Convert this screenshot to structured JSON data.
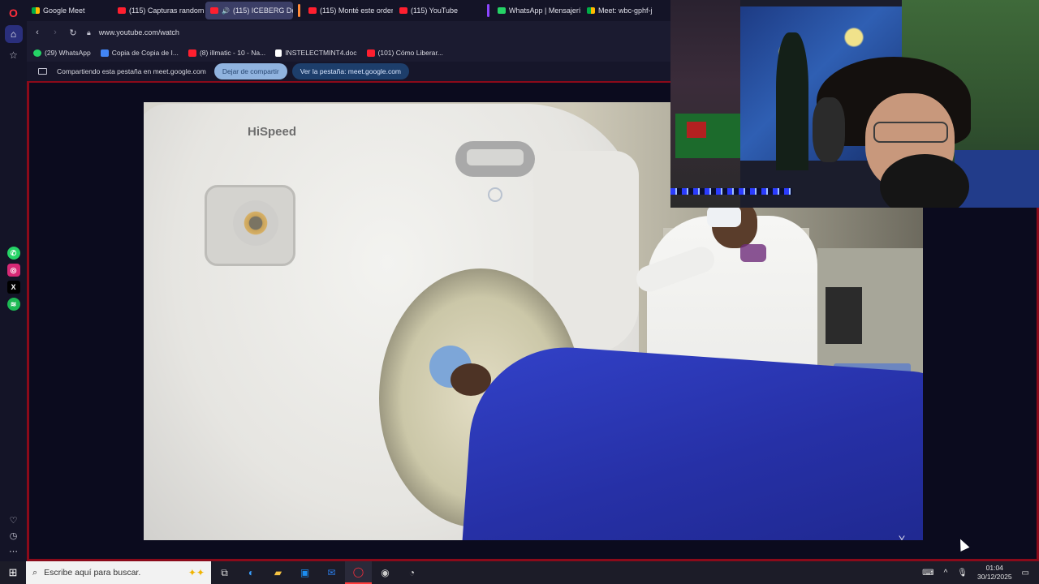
{
  "tabs": [
    {
      "label": "Google Meet",
      "favicon": "meet-icon"
    },
    {
      "label": "(115) Capturas random sin",
      "favicon": "youtube-icon"
    },
    {
      "label": "(115) ICEBERG De CA",
      "favicon": "youtube-icon",
      "active": true
    },
    {
      "label": "(115) Monté este ordenad",
      "favicon": "youtube-icon"
    },
    {
      "label": "(115) YouTube",
      "favicon": "youtube-icon"
    },
    {
      "label": "WhatsApp | Mensajería y",
      "favicon": "whatsapp-icon"
    },
    {
      "label": "Meet: wbc-gphf-j",
      "favicon": "meet-icon"
    }
  ],
  "address": {
    "url": "www.youtube.com/watch"
  },
  "bookmarks": [
    {
      "label": "(29) WhatsApp",
      "color": "#25d366"
    },
    {
      "label": "Copia de Copia de I...",
      "color": "#4285f4"
    },
    {
      "label": "(8) illmatic - 10 - Na...",
      "color": "#ff1f2f"
    },
    {
      "label": "INSTELECTMINT4.doc",
      "color": "#ffffff"
    },
    {
      "label": "(101) Cómo Liberar...",
      "color": "#ff1f2f"
    }
  ],
  "sharebar": {
    "text": "Compartiendo esta pestaña en meet.google.com",
    "stop_label": "Dejar de compartir",
    "view_label": "Ver la pestaña: meet.google.com"
  },
  "video": {
    "brand": "HiSpeed",
    "watermark": "Y."
  },
  "taskbar": {
    "search_placeholder": "Escribe aquí para buscar.",
    "time": "01:04",
    "date": "30/12/2025"
  },
  "colors": {
    "accent": "#8b0a1a",
    "sidebar": "#141427",
    "taskbar": "#1c1c28"
  }
}
